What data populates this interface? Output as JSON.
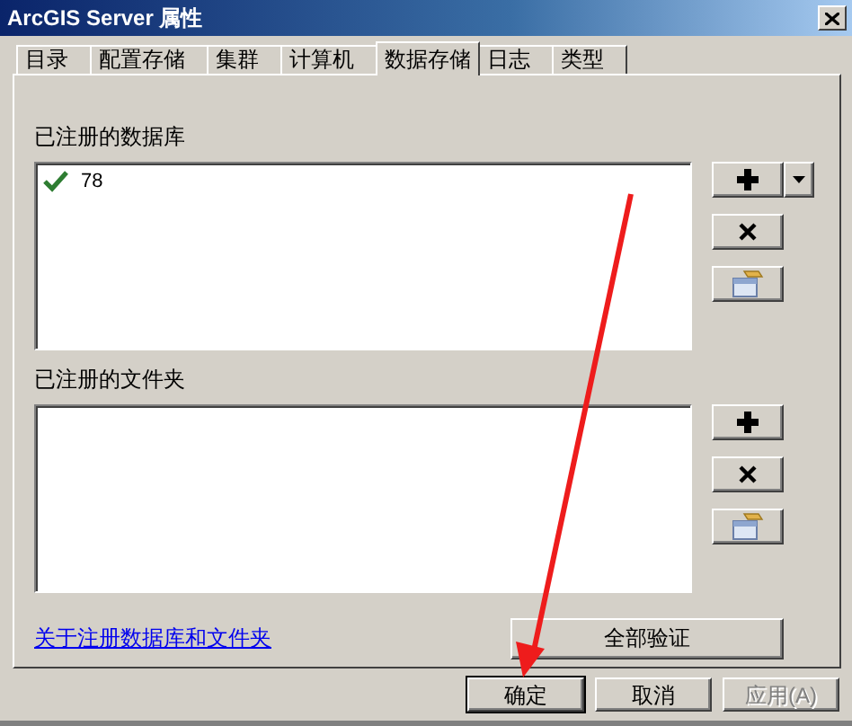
{
  "window": {
    "title": "ArcGIS Server 属性"
  },
  "tabs": [
    {
      "label": "目录",
      "selected": false
    },
    {
      "label": "配置存储",
      "selected": false
    },
    {
      "label": "集群",
      "selected": false
    },
    {
      "label": "计算机",
      "selected": false
    },
    {
      "label": "数据存储",
      "selected": true
    },
    {
      "label": "日志",
      "selected": false
    },
    {
      "label": "类型",
      "selected": false
    }
  ],
  "databases": {
    "label": "已注册的数据库",
    "items": [
      {
        "name": "78",
        "valid": true
      }
    ],
    "buttons": [
      {
        "kind": "add",
        "dropdown": true
      },
      {
        "kind": "remove"
      },
      {
        "kind": "properties"
      }
    ]
  },
  "folders": {
    "label": "已注册的文件夹",
    "buttons": [
      {
        "kind": "add",
        "dropdown": false
      },
      {
        "kind": "remove"
      },
      {
        "kind": "properties"
      }
    ]
  },
  "help_link": "关于注册数据库和文件夹",
  "validate_all_button": "全部验证",
  "dialog_buttons": [
    {
      "label": "确定",
      "default": true,
      "disabled": false
    },
    {
      "label": "取消",
      "default": false,
      "disabled": false
    },
    {
      "label": "应用(A)",
      "default": false,
      "disabled": true
    }
  ],
  "annotation": {
    "kind": "arrow"
  }
}
